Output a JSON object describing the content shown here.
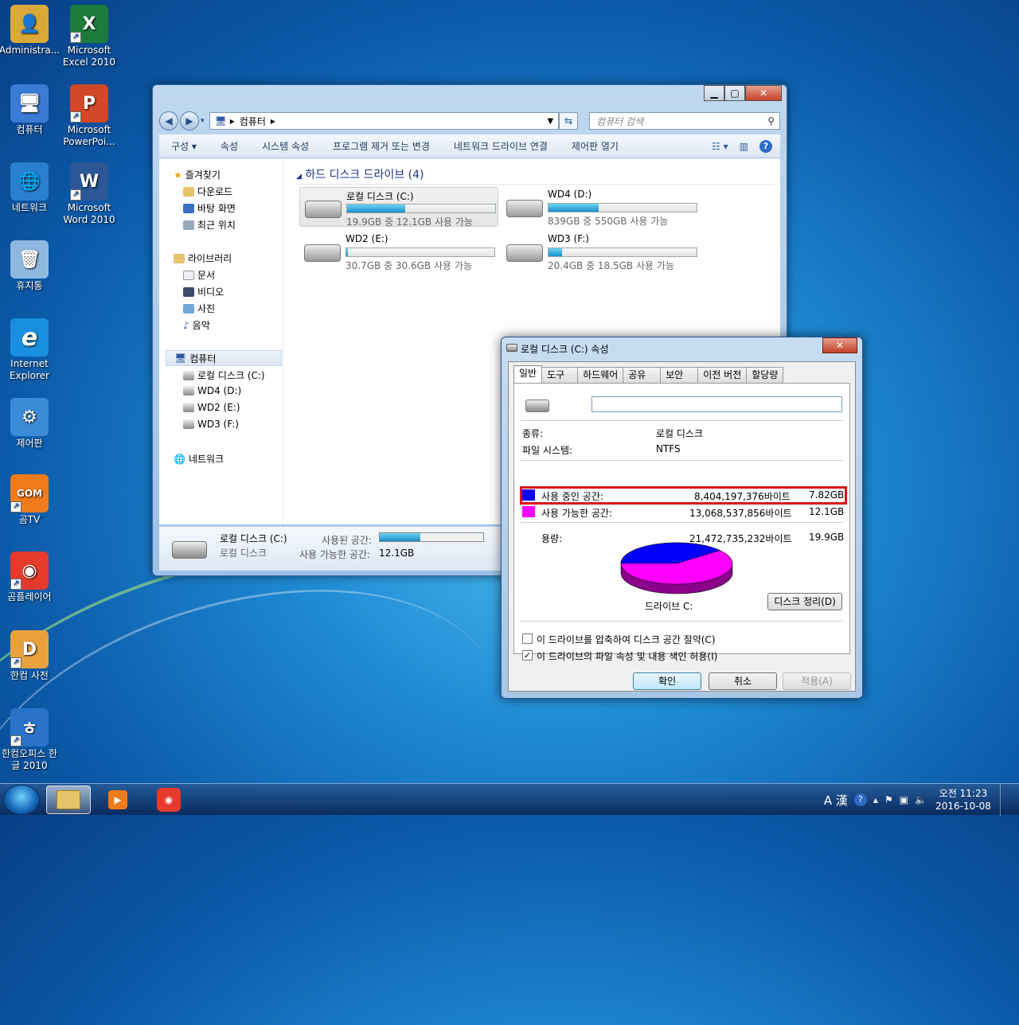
{
  "desktop": {
    "icons": [
      {
        "label": "Administra...",
        "color": "#d9a93a",
        "glyph": "👤"
      },
      {
        "label": "Microsoft Excel 2010",
        "color": "#1e7b3e",
        "glyph": "X"
      },
      {
        "label": "컴퓨터",
        "color": "#3a7bd5",
        "glyph": "🖥"
      },
      {
        "label": "Microsoft PowerPoi...",
        "color": "#d24726",
        "glyph": "P"
      },
      {
        "label": "네트워크",
        "color": "#2b7fd0",
        "glyph": "🌐"
      },
      {
        "label": "Microsoft Word 2010",
        "color": "#2b5797",
        "glyph": "W"
      },
      {
        "label": "휴지통",
        "color": "#8fb8e0",
        "glyph": "🗑"
      },
      {
        "label": "Internet Explorer",
        "color": "#1a8fe0",
        "glyph": "e"
      },
      {
        "label": "제어판",
        "color": "#3c8bd6",
        "glyph": "⚙"
      },
      {
        "label": "곰TV",
        "color": "#f07b1a",
        "glyph": "GOM"
      },
      {
        "label": "곰플레이어",
        "color": "#e53a2c",
        "glyph": "◉"
      },
      {
        "label": "한컴 사전",
        "color": "#e9a23b",
        "glyph": "D"
      },
      {
        "label": "한컴오피스 한글 2010",
        "color": "#2a73c9",
        "glyph": "ㅎ"
      }
    ]
  },
  "explorer": {
    "address_path": "컴퓨터",
    "search_placeholder": "컴퓨터 검색",
    "toolbar": [
      "구성 ▾",
      "속성",
      "시스템 속성",
      "프로그램 제거 또는 변경",
      "네트워크 드라이브 연결",
      "제어판 열기"
    ],
    "sidebar": {
      "favorites": "즐겨찾기",
      "favorites_items": [
        "다운로드",
        "바탕 화면",
        "최근 위치"
      ],
      "libraries": "라이브러리",
      "libraries_items": [
        "문서",
        "비디오",
        "사진",
        "음악"
      ],
      "computer": "컴퓨터",
      "computer_items": [
        "로컬 디스크 (C:)",
        "WD4 (D:)",
        "WD2 (E:)",
        "WD3 (F:)"
      ],
      "network": "네트워크"
    },
    "group_header": "하드 디스크 드라이브 (4)",
    "drives": [
      {
        "name": "로컬 디스크 (C:)",
        "info": "19.9GB 중 12.1GB 사용 가능",
        "used_fraction": 0.39
      },
      {
        "name": "WD4 (D:)",
        "info": "839GB 중 550GB 사용 가능",
        "used_fraction": 0.34
      },
      {
        "name": "WD2 (E:)",
        "info": "30.7GB 중 30.6GB 사용 가능",
        "used_fraction": 0.01
      },
      {
        "name": "WD3 (F:)",
        "info": "20.4GB 중 18.5GB 사용 가능",
        "used_fraction": 0.09
      }
    ],
    "details": {
      "name": "로컬 디스크 (C:)",
      "type": "로컬 디스크",
      "used_label": "사용된 공간:",
      "free_label": "사용 가능한 공간:",
      "free_value": "12.1GB",
      "used_fraction": 0.39
    }
  },
  "dialog": {
    "title": "로컬 디스크 (C:) 속성",
    "tabs": [
      "일반",
      "도구",
      "하드웨어",
      "공유",
      "보안",
      "이전 버전",
      "할당량"
    ],
    "name_value": "",
    "type_label": "종류:",
    "type_value": "로컬 디스크",
    "fs_label": "파일 시스템:",
    "fs_value": "NTFS",
    "used_label": "사용 중인 공간:",
    "used_bytes": "8,404,197,376바이트",
    "used_gb": "7.82GB",
    "free_label": "사용 가능한 공간:",
    "free_bytes": "13,068,537,856바이트",
    "free_gb": "12.1GB",
    "capacity_label": "용량:",
    "capacity_bytes": "21,472,735,232바이트",
    "capacity_gb": "19.9GB",
    "drive_label": "드라이브 C:",
    "cleanup_button": "디스크 정리(D)",
    "compress_label": "이 드라이브를 압축하여 디스크 공간 절약(C)",
    "index_label": "이 드라이브의 파일 속성 및 내용 색인 허용(I)",
    "compress_checked": false,
    "index_checked": true,
    "ok_button": "확인",
    "cancel_button": "취소",
    "apply_button": "적용(A)",
    "used_color": "#0000ff",
    "free_color": "#ff00ff"
  },
  "taskbar": {
    "tray_lang": "A 漢",
    "time": "오전 11:23",
    "date": "2016-10-08"
  }
}
